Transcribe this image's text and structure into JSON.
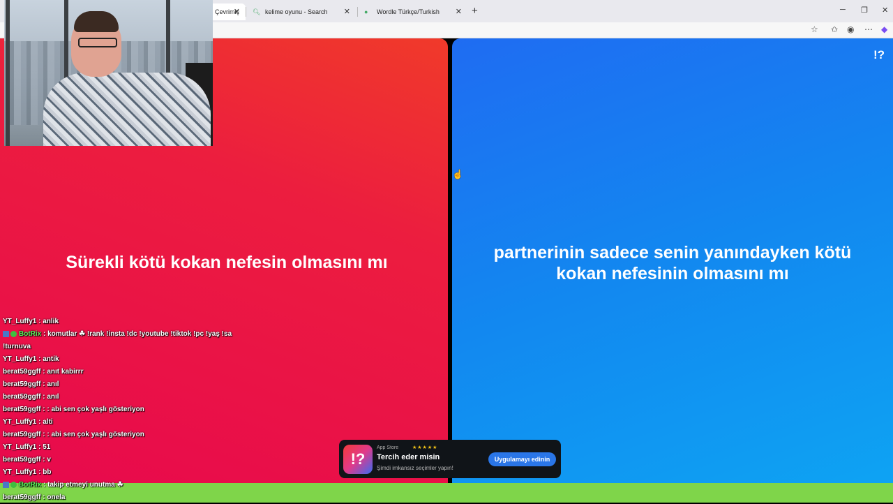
{
  "browser": {
    "tabs": [
      {
        "label": "Çevrimiç",
        "icon": "globe-icon"
      },
      {
        "label": "kelime oyunu - Search",
        "icon": "search-icon"
      },
      {
        "label": "Wordle Türkçe/Turkish",
        "icon": "globe-icon"
      }
    ],
    "new_tab_label": "+",
    "window_controls": {
      "minimize": "─",
      "restore": "❐",
      "close": "✕"
    }
  },
  "game": {
    "brand": "!?",
    "left_option": "Sürekli kötü kokan nefesin olmasını mı",
    "right_option": "partnerinin sadece senin yanındayken kötü kokan nefesinin olmasını mı",
    "colors": {
      "left_panel": "#ec1d3f",
      "right_panel": "#1288f0",
      "bottom_bar": "#7fd54a"
    }
  },
  "chat": {
    "messages": [
      {
        "user": "YT_Luffy1",
        "text": " : anlik",
        "bot": false
      },
      {
        "user": "BotRix",
        "text": " : komutlar ☘ !rank !insta !dc !youtube !tiktok !pc !yaş !sa",
        "bot": true
      },
      {
        "user": "",
        "text": "!turnuva",
        "bot": false
      },
      {
        "user": "YT_Luffy1",
        "text": " : antik",
        "bot": false
      },
      {
        "user": "berat59ggff",
        "text": " : anıt kabirrr",
        "bot": false
      },
      {
        "user": "berat59ggff",
        "text": " : anıl",
        "bot": false
      },
      {
        "user": "berat59ggff",
        "text": " : anıl",
        "bot": false
      },
      {
        "user": "berat59ggff",
        "text": " : : abi sen çok yaşlı gösteriyon",
        "bot": false
      },
      {
        "user": "YT_Luffy1",
        "text": " : alti",
        "bot": false
      },
      {
        "user": "berat59ggff",
        "text": " : : abi sen çok yaşlı gösteriyon",
        "bot": false
      },
      {
        "user": "YT_Luffy1",
        "text": " : 51",
        "bot": false
      },
      {
        "user": "berat59ggff",
        "text": " : v",
        "bot": false
      },
      {
        "user": "YT_Luffy1",
        "text": " : bb",
        "bot": false
      },
      {
        "user": "BotRix",
        "text": " : takip etmeyi unutma ☘",
        "bot": true
      },
      {
        "user": "berat59ggff",
        "text": " : onela",
        "bot": false
      }
    ]
  },
  "banner": {
    "store": "App Store",
    "stars": "★★★★★",
    "title": "Tercih eder misin",
    "subtitle": "Şimdi imkansız seçimler yapın!",
    "cta": "Uygulamayı edinin",
    "logo": "!?"
  }
}
